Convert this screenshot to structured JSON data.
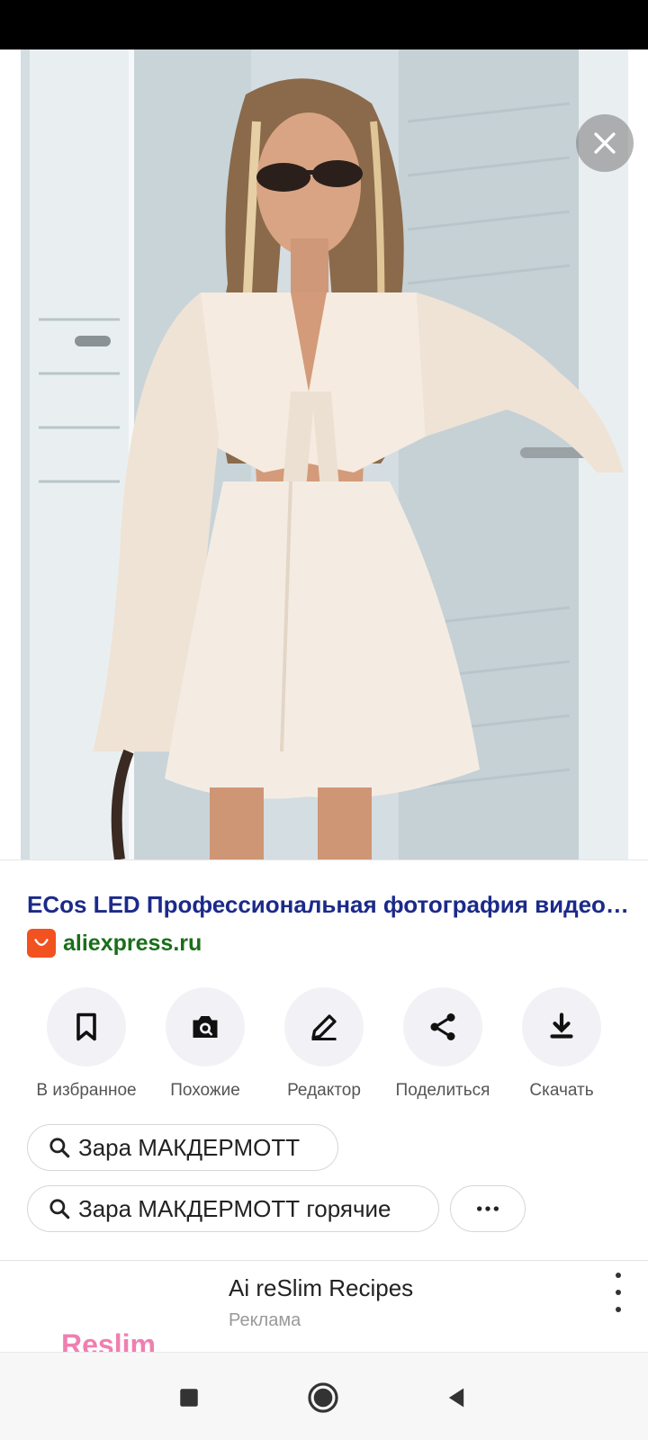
{
  "viewer": {
    "close_icon": "close-icon"
  },
  "result": {
    "title": "ECos LED Профессиональная фотография видео…",
    "source": "aliexpress.ru",
    "source_icon_color": "#f1521f"
  },
  "actions": [
    {
      "label": "В избранное",
      "icon": "bookmark-icon"
    },
    {
      "label": "Похожие",
      "icon": "camera-search-icon"
    },
    {
      "label": "Редактор",
      "icon": "pencil-icon"
    },
    {
      "label": "Поделиться",
      "icon": "share-icon"
    },
    {
      "label": "Скачать",
      "icon": "download-icon"
    }
  ],
  "related_searches": [
    {
      "label": "Зара МАКДЕРМОТТ"
    },
    {
      "label": "Зара МАКДЕРМОТТ горячие"
    }
  ],
  "ad": {
    "title": "Ai reSlim Recipes",
    "subtitle": "Реклама",
    "logo_text": "Reslim"
  },
  "colors": {
    "title_link": "#1b2a8a",
    "source_green": "#1a6e1a",
    "accent_pink": "#f07fb1"
  }
}
